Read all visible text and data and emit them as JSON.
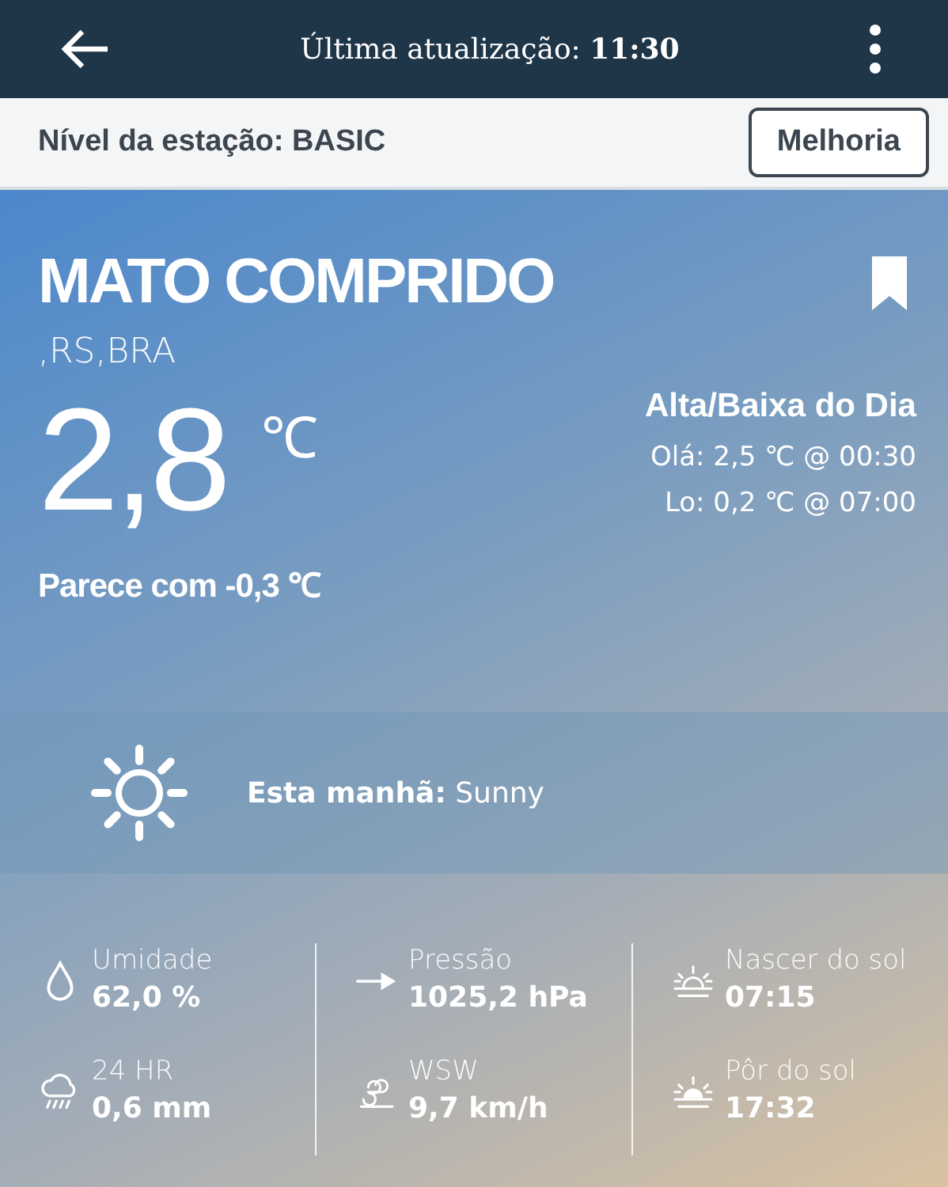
{
  "header": {
    "update_label": "Última atualização: **11:30**"
  },
  "station": {
    "level_label": "Nível da estação: BASIC",
    "upgrade_button": "Melhoria"
  },
  "location": {
    "name": "MATO COMPRIDO",
    "region": ",RS,BRA",
    "bookmarked": true
  },
  "current": {
    "temperature": "2,8",
    "unit": "℃",
    "feels_like": "Parece com -0,3 ℃"
  },
  "high_low": {
    "title": "Alta/Baixa do Dia",
    "high": "Olá: 2,5 ℃ @ 00:30",
    "low": "Lo: 0,2 ℃ @ 07:00"
  },
  "forecast": {
    "kind": "sun",
    "text": "**Esta manhã:** Sunny"
  },
  "stats": [
    [
      {
        "kind": "drop",
        "label": "Umidade",
        "value": "62,0 %"
      },
      {
        "kind": "rain",
        "label": "24 HR",
        "value": "0,6 mm"
      }
    ],
    [
      {
        "kind": "arrow",
        "label": "Pressão",
        "value": "1025,2 hPa"
      },
      {
        "kind": "wind",
        "label": "WSW",
        "value": "9,7 km/h"
      }
    ],
    [
      {
        "kind": "sunrise",
        "label": "Nascer do sol",
        "value": "07:15"
      },
      {
        "kind": "sunset",
        "label": "Pôr do sol",
        "value": "17:32"
      }
    ]
  ]
}
